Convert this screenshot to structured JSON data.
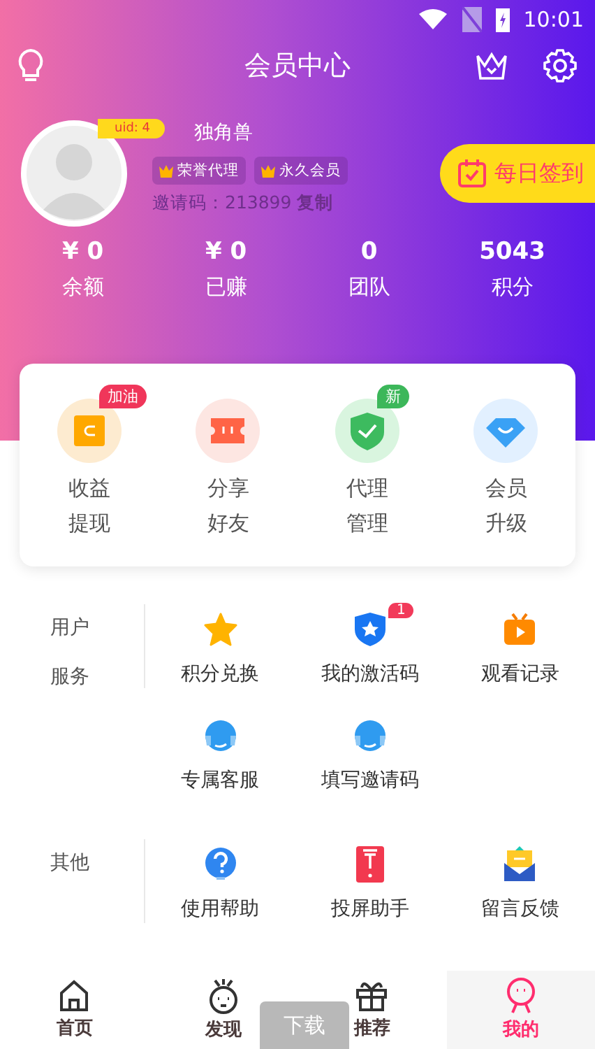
{
  "status_bar": {
    "time": "10:01"
  },
  "header": {
    "title": "会员中心"
  },
  "profile": {
    "uid": "uid: 4",
    "name": "独角兽",
    "tags": [
      "荣誉代理",
      "永久会员"
    ],
    "invite_label": "邀请码：213899",
    "copy_link": "复制",
    "checkin_button": "每日签到"
  },
  "stats": [
    {
      "value": "¥ 0",
      "label": "余额"
    },
    {
      "value": "¥ 0",
      "label": "已赚"
    },
    {
      "value": "0",
      "label": "团队"
    },
    {
      "value": "5043",
      "label": "积分"
    }
  ],
  "quick_actions": [
    {
      "kind": "wallet",
      "lines": [
        "收益",
        "提现"
      ],
      "badge": "加油",
      "color": "#f0365a"
    },
    {
      "kind": "ticket",
      "lines": [
        "分享",
        "好友"
      ]
    },
    {
      "kind": "shield",
      "lines": [
        "代理",
        "管理"
      ],
      "badge": "新",
      "color": "#3cb75a"
    },
    {
      "kind": "diamond",
      "lines": [
        "会员",
        "升级"
      ]
    }
  ],
  "sections": [
    {
      "label_lines": [
        "用户",
        "服务"
      ],
      "items": [
        {
          "kind": "star",
          "label": "积分兑换"
        },
        {
          "kind": "badge",
          "label": "我的激活码",
          "badge": "1"
        },
        {
          "kind": "tv",
          "label": "观看记录"
        },
        {
          "kind": "headset",
          "label": "专属客服"
        },
        {
          "kind": "headset",
          "label": "填写邀请码"
        }
      ]
    },
    {
      "label_lines": [
        "其他"
      ],
      "items": [
        {
          "kind": "help",
          "label": "使用帮助"
        },
        {
          "kind": "cast",
          "label": "投屏助手"
        },
        {
          "kind": "mail",
          "label": "留言反馈"
        }
      ]
    }
  ],
  "download_toast": "下载",
  "bottom_nav": [
    {
      "kind": "home",
      "label": "首页",
      "selected": false
    },
    {
      "kind": "discover",
      "label": "发现",
      "selected": false
    },
    {
      "kind": "gift",
      "label": "推荐",
      "selected": false
    },
    {
      "kind": "me",
      "label": "我的",
      "selected": true
    }
  ]
}
